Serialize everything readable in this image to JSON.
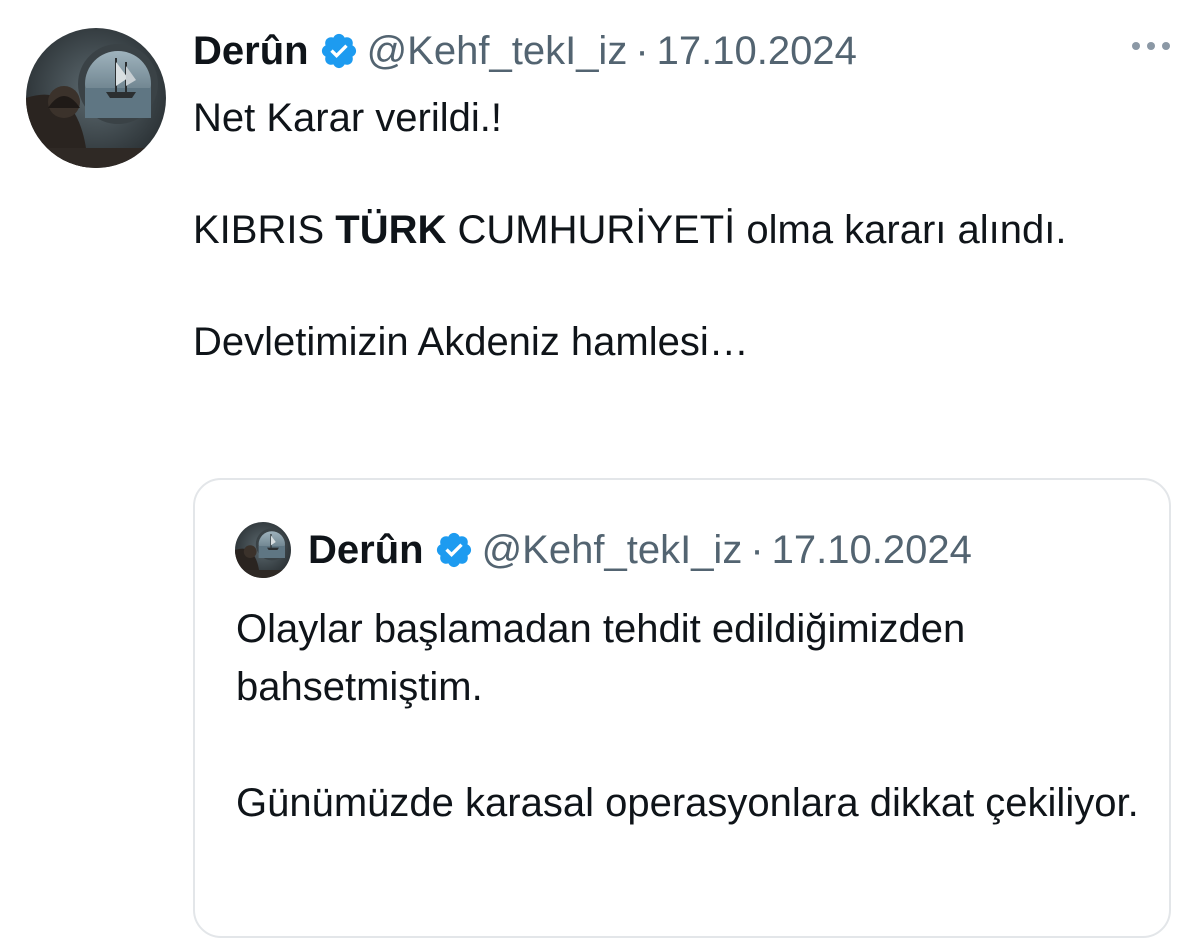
{
  "tweet": {
    "author_name": "Derûn",
    "handle": "@Kehf_tekI_iz",
    "separator": "·",
    "date": "17.10.2024",
    "avatar_icon": "ship-porthole-avatar",
    "verified_icon": "verified-badge-icon",
    "more_icon": "more-options-icon",
    "text": {
      "line1": "Net Karar verildi.!",
      "para2_prefix": "KIBRIS ",
      "para2_bold": "TÜRK",
      "para2_suffix": " CUMHURİYETİ olma kararı alındı.",
      "para3": "Devletimizin Akdeniz hamlesi…"
    }
  },
  "quoted_tweet": {
    "author_name": "Derûn",
    "handle": "@Kehf_tekI_iz",
    "separator": "·",
    "date": "17.10.2024",
    "text": {
      "para1": "Olaylar başlamadan tehdit edildiğimizden bahsetmiştim.",
      "para2": "Günümüzde karasal operasyonlara dikkat çekiliyor."
    }
  },
  "colors": {
    "text": "#0f1419",
    "secondary": "#536471",
    "verified": "#1d9bf0",
    "border": "#e3e6e9"
  }
}
